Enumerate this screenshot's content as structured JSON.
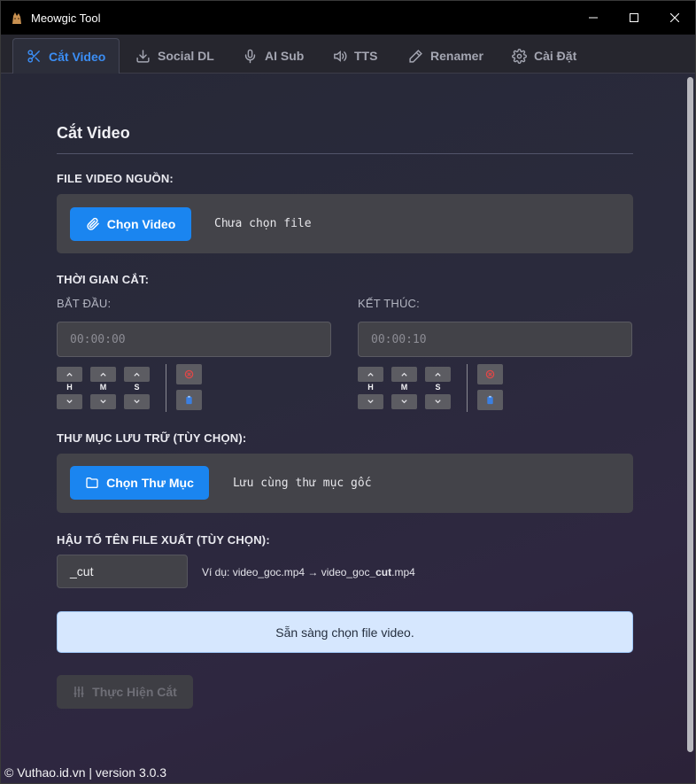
{
  "window": {
    "title": "Meowgic Tool",
    "controls": [
      "minimize",
      "maximize",
      "close"
    ]
  },
  "tabs": [
    {
      "label": "Cắt Video",
      "icon": "scissors-icon",
      "active": true
    },
    {
      "label": "Social DL",
      "icon": "download-icon",
      "active": false
    },
    {
      "label": "AI Sub",
      "icon": "microphone-icon",
      "active": false
    },
    {
      "label": "TTS",
      "icon": "speaker-icon",
      "active": false
    },
    {
      "label": "Renamer",
      "icon": "pencil-icon",
      "active": false
    },
    {
      "label": "Cài Đặt",
      "icon": "gear-icon",
      "active": false
    }
  ],
  "main": {
    "title": "Cắt Video",
    "source": {
      "label": "FILE VIDEO NGUỒN:",
      "button": "Chọn Video",
      "status": "Chưa chọn file"
    },
    "time": {
      "label": "THỜI GIAN CẮT:",
      "start": {
        "label": "BẮT ĐẦU:",
        "placeholder": "00:00:00"
      },
      "end": {
        "label": "KẾT THÚC:",
        "placeholder": "00:00:10"
      },
      "spin_labels": [
        "H",
        "M",
        "S"
      ]
    },
    "output_dir": {
      "label": "THƯ MỤC LƯU TRỮ (TÙY CHỌN):",
      "button": "Chọn Thư Mục",
      "status": "Lưu cùng thư mục gốc"
    },
    "suffix": {
      "label": "HẬU TỐ TÊN FILE XUẤT (TÙY CHỌN):",
      "value": "_cut",
      "example_prefix": "Ví dụ: video_goc.mp4 → video_goc",
      "example_bold": "_cut",
      "example_suffix": ".mp4"
    },
    "status_message": "Sẵn sàng chọn file video.",
    "run_button": "Thực Hiện Cắt"
  },
  "footer": "© Vuthao.id.vn | version 3.0.3",
  "colors": {
    "accent": "#1a85f0",
    "status_bg": "#d6e7fe",
    "panel_bg": "#434349"
  }
}
